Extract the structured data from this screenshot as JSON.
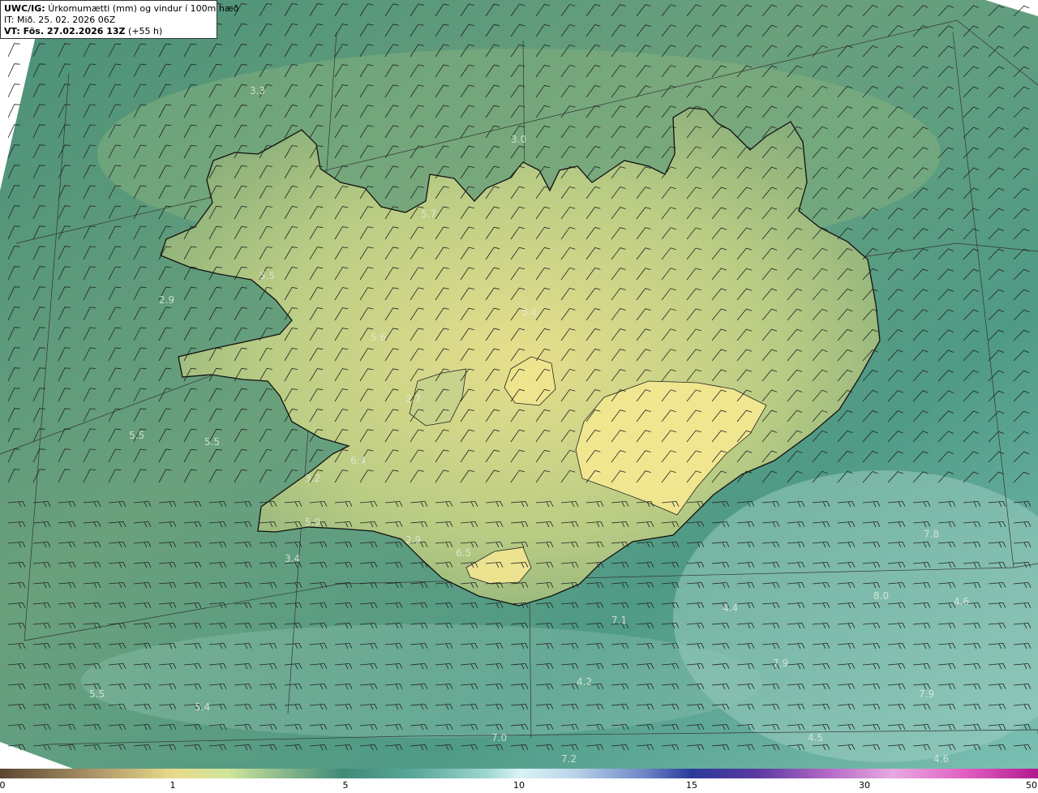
{
  "header": {
    "model_label": "UWC/IG:",
    "title": "Úrkomumætti (mm) og vindur í 100m hæð",
    "init_time": "IT: Mið. 25. 02. 2026 06Z",
    "valid_label": "VT: Fös. 27.02.2026 13Z",
    "lead_time": "(+55 h)"
  },
  "colorbar": {
    "ticks": [
      "0",
      "1",
      "5",
      "10",
      "15",
      "30",
      "50"
    ],
    "colors": {
      "low": "#5a4632",
      "one": "#e8d98a",
      "five": "#3f8b78",
      "ten": "#d9f3f5",
      "fifteen": "#2a3a9a",
      "thirty": "#e8a9e0",
      "fifty": "#b01a8e"
    }
  },
  "map": {
    "land_color": "#cfd58a",
    "sea_color": "#3f8b78",
    "coast_color": "#111111",
    "point_labels": [
      {
        "text": "3.3",
        "lon": -25.0,
        "lat": 67.7
      },
      {
        "text": "3.0",
        "lon": -19.8,
        "lat": 67.3
      },
      {
        "text": "5.7",
        "lon": -21.6,
        "lat": 66.7
      },
      {
        "text": "5.5",
        "lon": -24.8,
        "lat": 66.2
      },
      {
        "text": "2.9",
        "lon": -26.8,
        "lat": 66.0
      },
      {
        "text": "5.4",
        "lon": -19.6,
        "lat": 65.9
      },
      {
        "text": "5.6",
        "lon": -22.6,
        "lat": 65.7
      },
      {
        "text": "2.7",
        "lon": -21.9,
        "lat": 65.2
      },
      {
        "text": "5.5",
        "lon": -27.4,
        "lat": 64.9
      },
      {
        "text": "5.5",
        "lon": -25.9,
        "lat": 64.85
      },
      {
        "text": "6.4",
        "lon": -23.0,
        "lat": 64.7
      },
      {
        "text": "3.2",
        "lon": -23.9,
        "lat": 64.55
      },
      {
        "text": "5.9",
        "lon": -23.9,
        "lat": 64.2
      },
      {
        "text": "2.9",
        "lon": -21.9,
        "lat": 64.05
      },
      {
        "text": "3.4",
        "lon": -24.3,
        "lat": 63.9
      },
      {
        "text": "6.5",
        "lon": -20.9,
        "lat": 63.95
      },
      {
        "text": "4.4",
        "lon": -15.6,
        "lat": 63.5
      },
      {
        "text": "7.1",
        "lon": -17.8,
        "lat": 63.4
      },
      {
        "text": "7.8",
        "lon": -11.6,
        "lat": 64.1
      },
      {
        "text": "8.0",
        "lon": -12.6,
        "lat": 63.6
      },
      {
        "text": "4.6",
        "lon": -11.0,
        "lat": 63.55
      },
      {
        "text": "7.9",
        "lon": -14.6,
        "lat": 63.05
      },
      {
        "text": "4.2",
        "lon": -18.5,
        "lat": 62.9
      },
      {
        "text": "5.5",
        "lon": -28.2,
        "lat": 62.8
      },
      {
        "text": "5.4",
        "lon": -26.1,
        "lat": 62.7
      },
      {
        "text": "7.9",
        "lon": -11.7,
        "lat": 62.8
      },
      {
        "text": "7.0",
        "lon": -20.2,
        "lat": 62.45
      },
      {
        "text": "4.5",
        "lon": -13.9,
        "lat": 62.45
      },
      {
        "text": "7.2",
        "lon": -18.8,
        "lat": 62.1
      },
      {
        "text": "4.6",
        "lon": -11.4,
        "lat": 62.0
      }
    ]
  }
}
